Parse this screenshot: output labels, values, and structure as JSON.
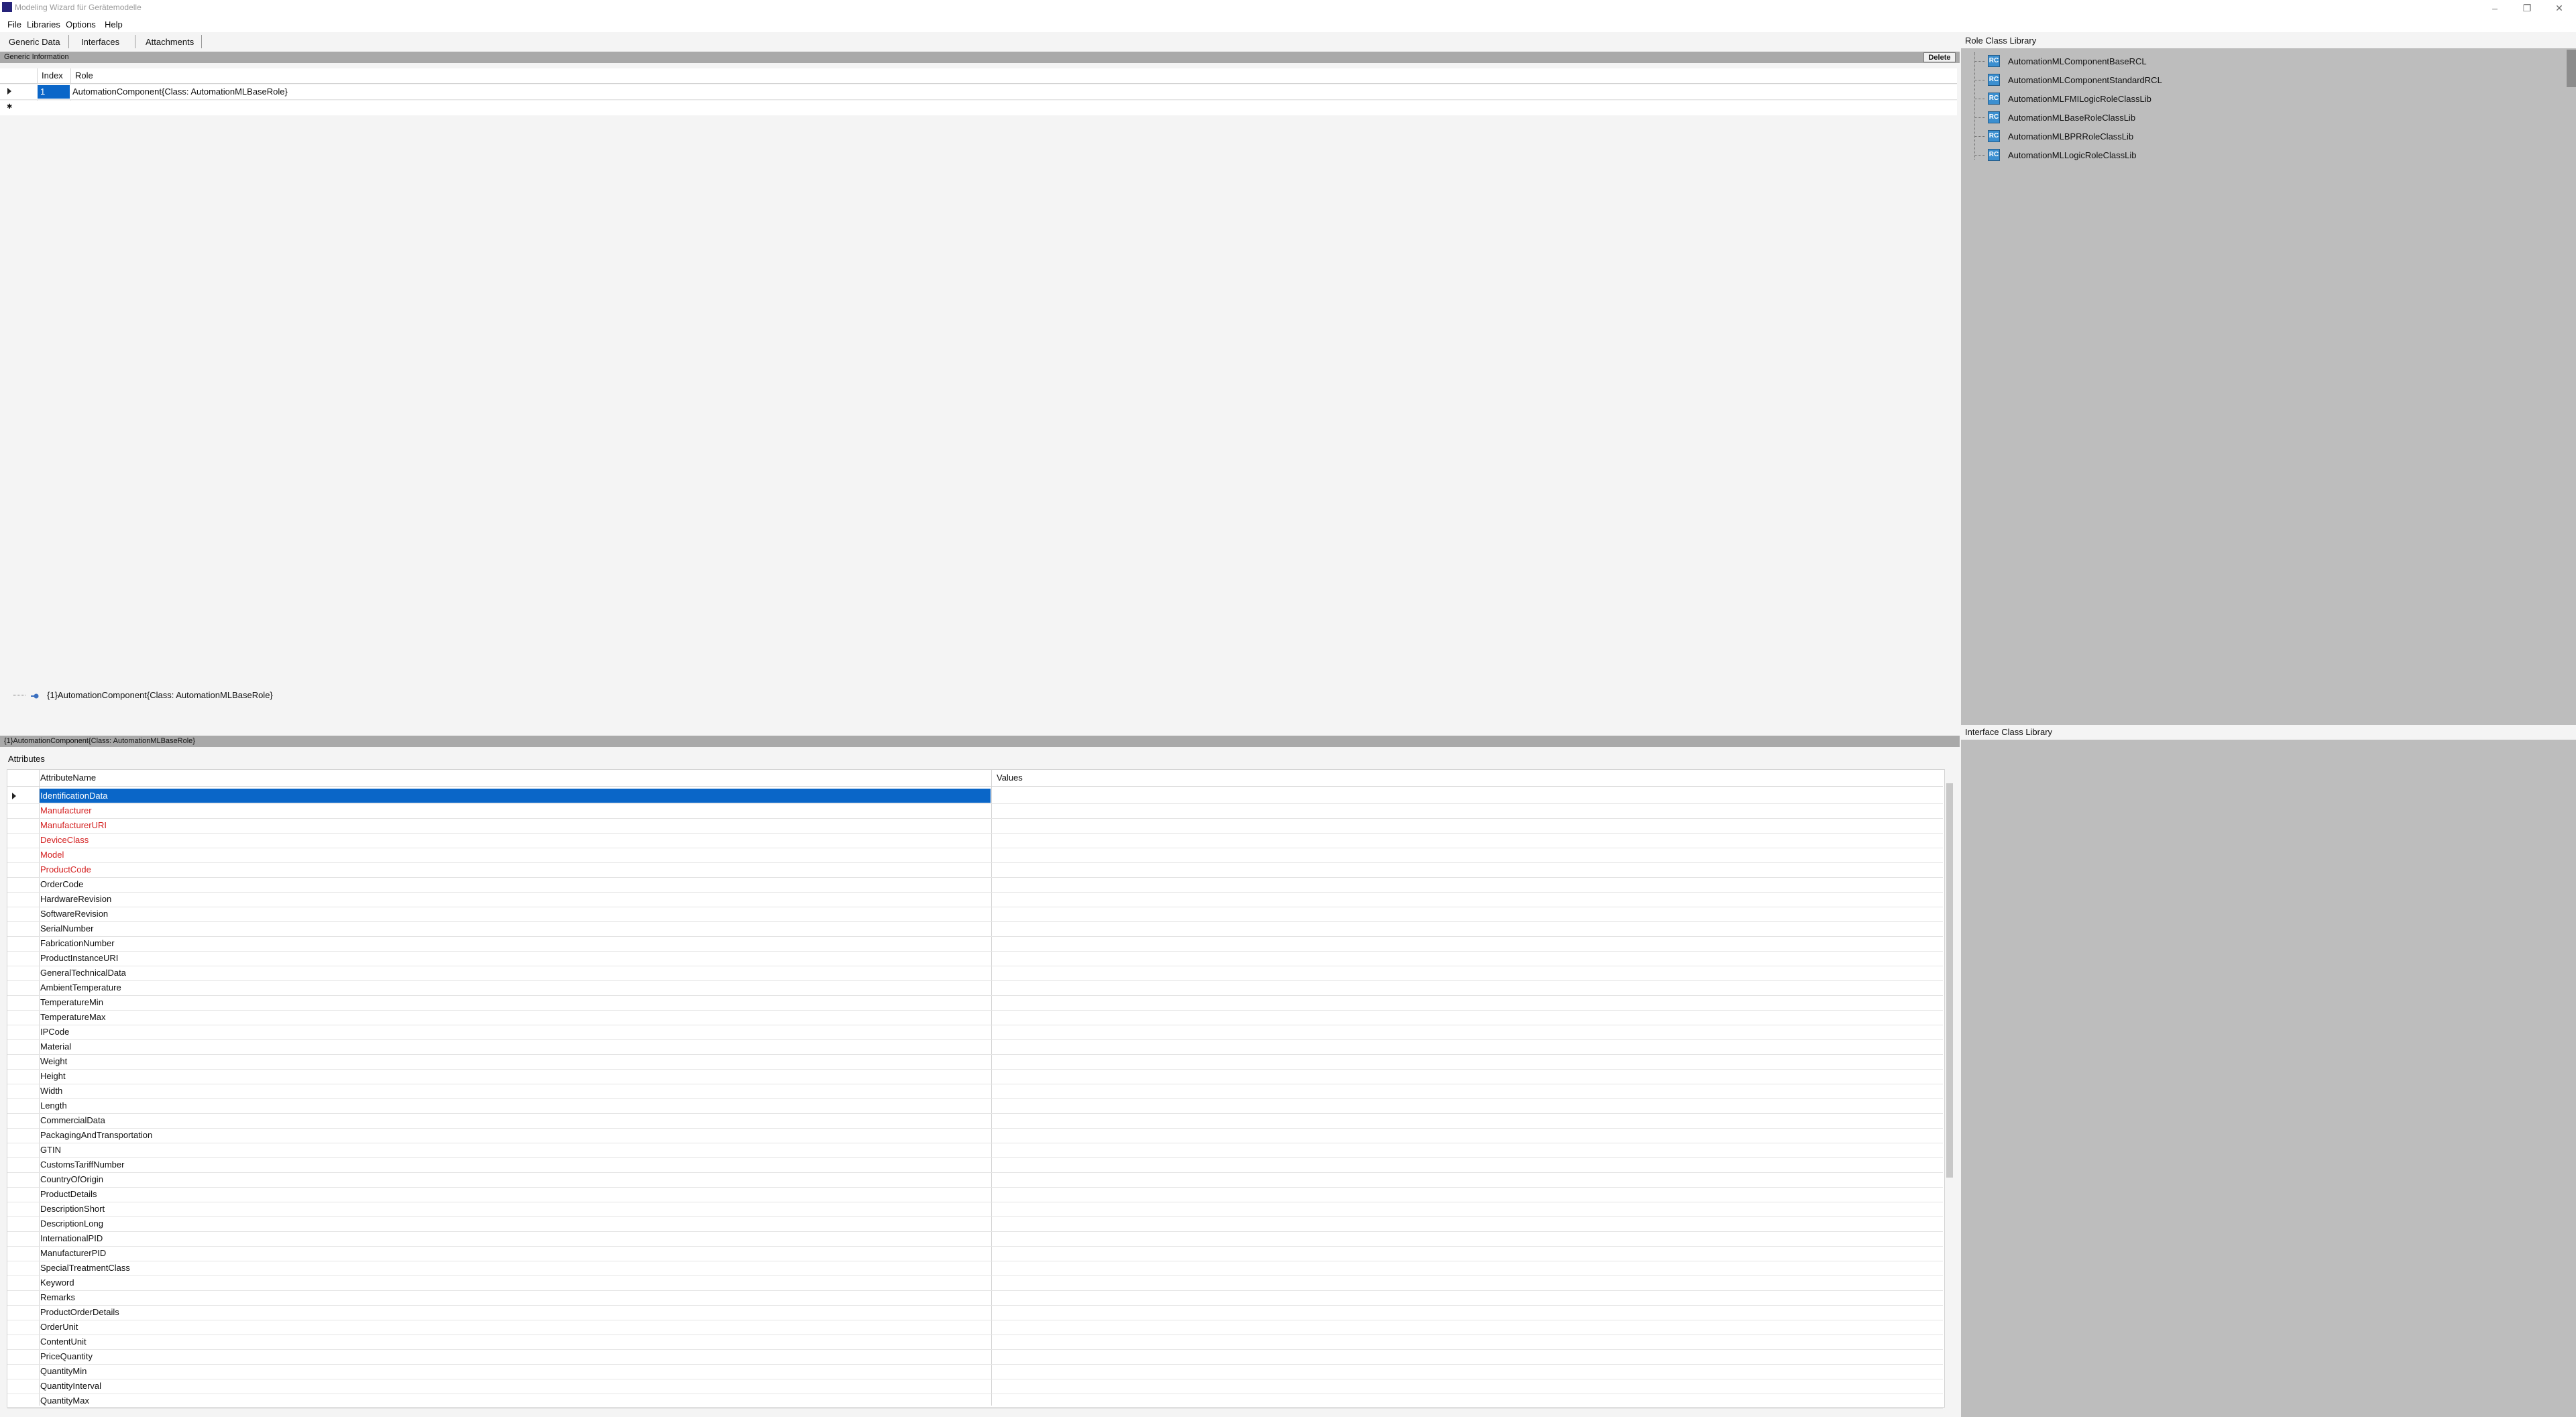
{
  "window": {
    "title": "Modeling Wizard für Gerätemodelle",
    "min_glyph": "–",
    "restore_glyph": "❐",
    "close_glyph": "✕"
  },
  "menu": [
    "File",
    "Libraries",
    "Options",
    "Help"
  ],
  "tabs": [
    "Generic Data",
    "Interfaces",
    "Attachments"
  ],
  "generic": {
    "header": "Generic Information",
    "delete_label": "Delete",
    "col_index": "Index",
    "col_role": "Role",
    "row_index": "1",
    "row_role": "AutomationComponent{Class:  AutomationMLBaseRole}",
    "new_row_glyph": "✱"
  },
  "tree": {
    "node": "{1}AutomationComponent{Class:  AutomationMLBaseRole}"
  },
  "selected_strip": "{1}AutomationComponent{Class:  AutomationMLBaseRole}",
  "attributes": {
    "label": "Attributes",
    "col_name": "AttributeName",
    "col_values": "Values",
    "rows": [
      "IdentificationData",
      "Manufacturer",
      "ManufacturerURI",
      "DeviceClass",
      "Model",
      "ProductCode",
      "OrderCode",
      "HardwareRevision",
      "SoftwareRevision",
      "SerialNumber",
      "FabricationNumber",
      "ProductInstanceURI",
      "GeneralTechnicalData",
      "AmbientTemperature",
      "TemperatureMin",
      "TemperatureMax",
      "IPCode",
      "Material",
      "Weight",
      "Height",
      "Width",
      "Length",
      "CommercialData",
      "PackagingAndTransportation",
      "GTIN",
      "CustomsTariffNumber",
      "CountryOfOrigin",
      "ProductDetails",
      "DescriptionShort",
      "DescriptionLong",
      "InternationalPID",
      "ManufacturerPID",
      "SpecialTreatmentClass",
      "Keyword",
      "Remarks",
      "ProductOrderDetails",
      "OrderUnit",
      "ContentUnit",
      "PriceQuantity",
      "QuantityMin",
      "QuantityInterval",
      "QuantityMax"
    ],
    "required_color": "#d42020",
    "selected_color": "#0a66c8"
  },
  "role_class_library": {
    "title": "Role Class Library",
    "icon_glyph": "RC",
    "items": [
      "AutomationMLComponentBaseRCL",
      "AutomationMLComponentStandardRCL",
      "AutomationMLFMILogicRoleClassLib",
      "AutomationMLBaseRoleClassLib",
      "AutomationMLBPRRoleClassLib",
      "AutomationMLLogicRoleClassLib"
    ]
  },
  "interface_class_library": {
    "title": "Interface Class Library"
  }
}
